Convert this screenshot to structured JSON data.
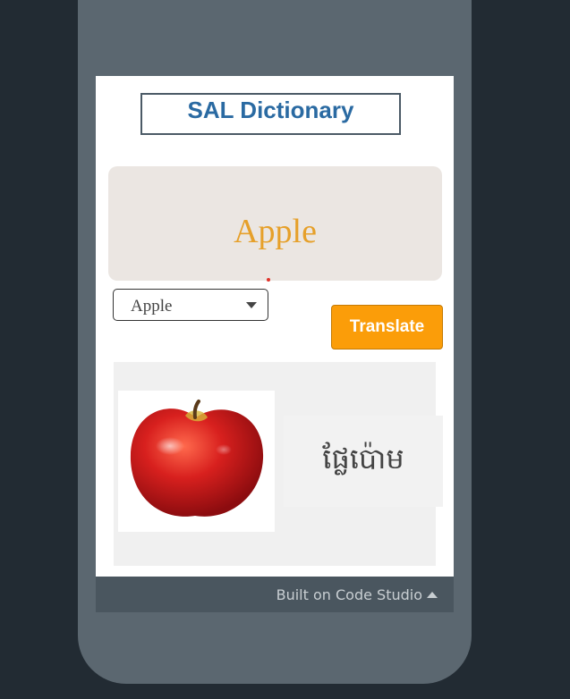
{
  "app": {
    "title": "SAL Dictionary"
  },
  "word_display": {
    "text": "Apple",
    "color": "#e6a02a"
  },
  "dropdown": {
    "selected": "Apple"
  },
  "translate_button": {
    "label": "Translate",
    "color": "#fb9d09"
  },
  "result": {
    "image_icon": "apple-image",
    "translation": "ផ្លែប៉ោម"
  },
  "footer": {
    "label": "Built on Code Studio",
    "icon": "caret-up-icon"
  }
}
